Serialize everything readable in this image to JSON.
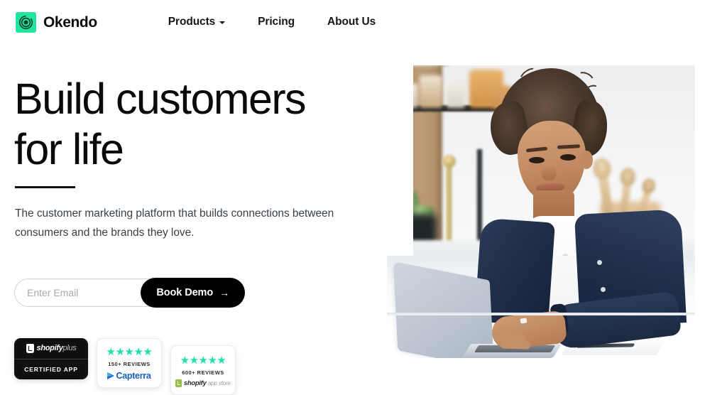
{
  "brand": {
    "name": "Okendo",
    "logo_icon": "okendo-concentric-circles-icon",
    "logo_bg_color": "#21E6A0"
  },
  "nav": {
    "items": [
      {
        "label": "Products",
        "has_dropdown": true,
        "icon": "chevron-down-icon"
      },
      {
        "label": "Pricing",
        "has_dropdown": false
      },
      {
        "label": "About Us",
        "has_dropdown": false
      }
    ]
  },
  "hero": {
    "headline_line1": "Build customers",
    "headline_line2": "for life",
    "subheadline": "The customer marketing platform that builds connections between consumers and the brands they love.",
    "image_alt": "Woman with curly hair smiling while typing on a silver laptop at a white kitchen counter",
    "accent_rule_color": "#111111"
  },
  "cta": {
    "email_placeholder": "Enter Email",
    "email_value": "",
    "button_label": "Book Demo",
    "button_icon": "arrow-right-icon",
    "button_arrow": "→",
    "button_bg_color": "#000000"
  },
  "badges": {
    "star_color": "#1FE0AD",
    "items": [
      {
        "type": "shopify-plus-certified",
        "brand": "shopify",
        "brand_suffix": "plus",
        "caption": "CERTIFIED APP",
        "bg_color": "#101010"
      },
      {
        "type": "capterra-rating",
        "stars": "★★★★★",
        "star_count": 5,
        "reviews": "150+ REVIEWS",
        "brand": "Capterra",
        "brand_color": "#1a5eb8"
      },
      {
        "type": "shopify-app-store-rating",
        "stars": "★★★★★",
        "star_count": 5,
        "reviews": "600+ REVIEWS",
        "brand": "shopify",
        "brand_suffix": "app store",
        "brand_color": "#95BF47"
      }
    ]
  }
}
